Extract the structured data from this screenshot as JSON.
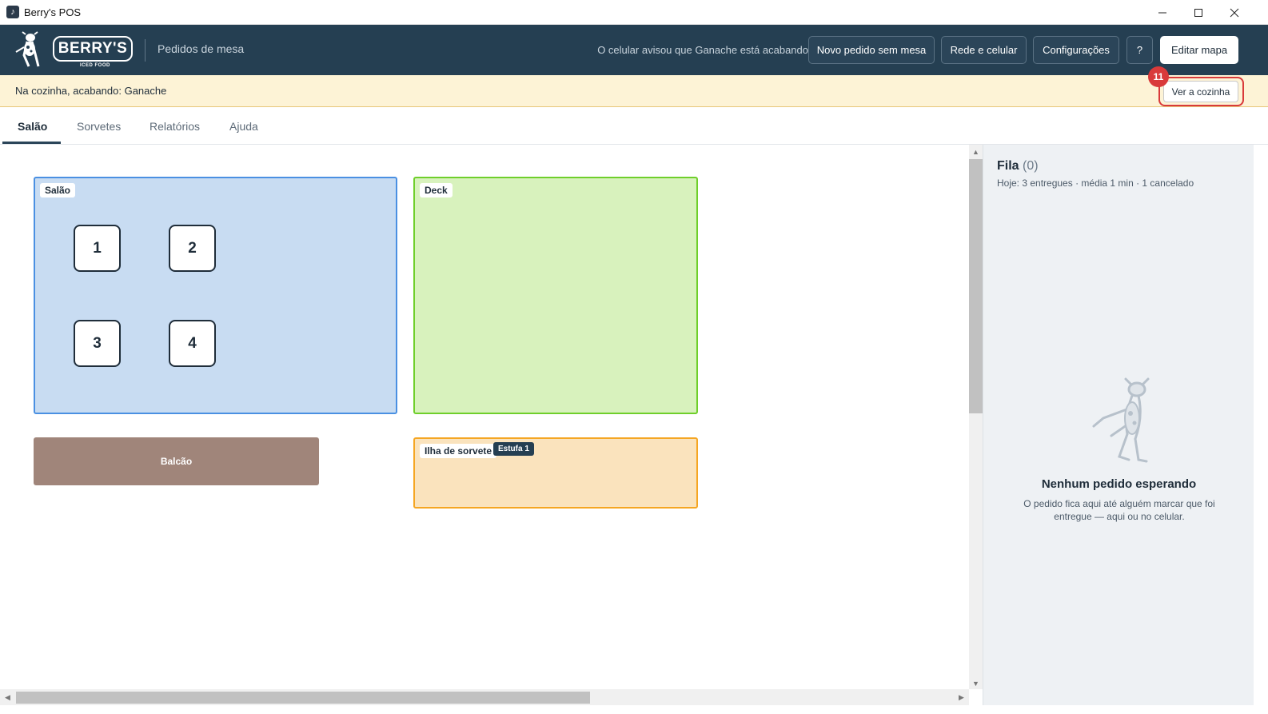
{
  "window": {
    "title": "Berry's POS",
    "minimize_icon": "minimize-icon",
    "maximize_icon": "maximize-icon",
    "close_icon": "close-icon"
  },
  "header": {
    "logo_text": "BERRY'S",
    "logo_subtext": "ICED FOOD",
    "subtitle": "Pedidos de mesa",
    "notice": "O celular avisou que Ganache está acabando",
    "buttons": {
      "new_order": "Novo pedido sem mesa",
      "network": "Rede e celular",
      "settings": "Configurações",
      "help": "?",
      "edit_map": "Editar mapa"
    },
    "bg_color": "#253f52"
  },
  "warning": {
    "text": "Na cozinha, acabando: Ganache",
    "button": "Ver a cozinha",
    "badge": "11",
    "bg_color": "#fdf3d6",
    "highlight_color": "#d93a3a"
  },
  "tabs": [
    {
      "label": "Salão",
      "active": true
    },
    {
      "label": "Sorvetes",
      "active": false
    },
    {
      "label": "Relatórios",
      "active": false
    },
    {
      "label": "Ajuda",
      "active": false
    }
  ],
  "floor_map": {
    "zones": {
      "salao": {
        "label": "Salão",
        "color": "#c8dcf2",
        "border": "#4a90e2"
      },
      "deck": {
        "label": "Deck",
        "color": "#d8f2bd",
        "border": "#6fcf2b"
      },
      "balcao": {
        "label": "Balcão",
        "color": "#a0857a"
      },
      "ilha": {
        "label": "Ilha de sorvete",
        "tag": "Estufa 1",
        "color": "#fae3bd",
        "border": "#f5a623"
      }
    },
    "tables": [
      "1",
      "2",
      "3",
      "4"
    ]
  },
  "queue": {
    "title": "Fila",
    "count": "(0)",
    "stats": "Hoje: 3 entregues · média 1 min · 1 cancelado",
    "empty_title": "Nenhum pedido esperando",
    "empty_text": "O pedido fica aqui até alguém marcar que foi entregue — aqui ou no celular.",
    "mascot_icon": "cow-mascot-icon"
  }
}
